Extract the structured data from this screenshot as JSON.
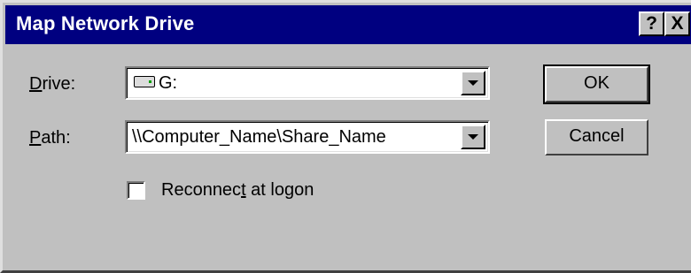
{
  "window": {
    "title": "Map Network Drive",
    "help_button": "?",
    "close_button": "X"
  },
  "drive": {
    "label_access_key": "D",
    "label_rest": "rive:",
    "value": "G:",
    "icon": "network-drive-icon"
  },
  "path": {
    "label_access_key": "P",
    "label_rest": "ath:",
    "value": "\\\\Computer_Name\\Share_Name"
  },
  "reconnect": {
    "label_before": "Reconnec",
    "label_access_key": "t",
    "label_after": " at logon",
    "checked": false
  },
  "buttons": {
    "ok": "OK",
    "cancel": "Cancel"
  },
  "colors": {
    "titlebar": "#000080",
    "face": "#c0c0c0"
  }
}
